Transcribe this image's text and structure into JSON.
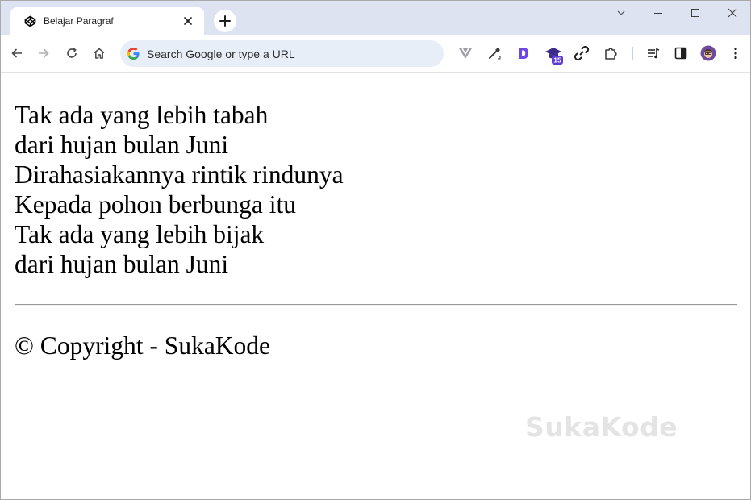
{
  "tab": {
    "title": "Belajar Paragraf"
  },
  "omnibox": {
    "placeholder": "Search Google or type a URL"
  },
  "extensions": {
    "badge_count": "15"
  },
  "page": {
    "poem_lines": [
      "Tak ada yang lebih tabah",
      "dari hujan bulan Juni",
      "Dirahasiakannya rintik rindunya",
      "Kepada pohon berbunga itu",
      "Tak ada yang lebih bijak",
      "dari hujan bulan Juni"
    ],
    "copyright": "© Copyright - SukaKode",
    "watermark": "SukaKode"
  },
  "colors": {
    "tabstrip_bg": "#dee3f1",
    "omnibox_bg": "#e8eef8",
    "extension_accent": "#5b3bd6"
  },
  "icons": [
    "codepen-icon",
    "close-icon",
    "plus-icon",
    "chevron-down-icon",
    "minimize-icon",
    "maximize-icon",
    "back-icon",
    "forward-icon",
    "reload-icon",
    "home-icon",
    "google-icon",
    "vuetify-icon",
    "eyedropper-icon",
    "d-extension-icon",
    "graduation-cap-icon",
    "link-extension-icon",
    "puzzle-icon",
    "media-control-icon",
    "side-panel-icon",
    "profile-avatar",
    "more-vert-icon"
  ]
}
